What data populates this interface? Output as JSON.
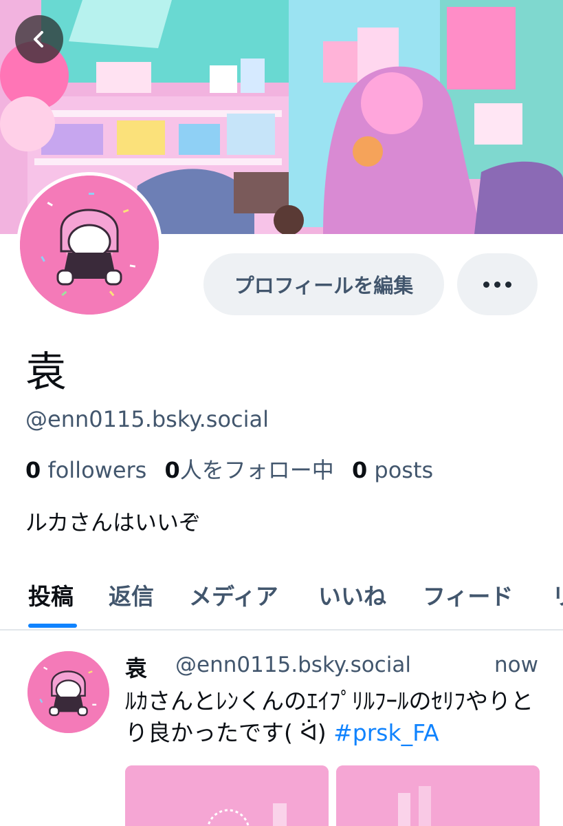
{
  "header": {
    "back_icon": "chevron-left-icon"
  },
  "profile": {
    "display_name": "袁",
    "handle": "@enn0115.bsky.social",
    "followers_count": "0",
    "followers_label": "followers",
    "following_count": "0",
    "following_label": "人をフォロー中",
    "posts_count": "0",
    "posts_label": "posts",
    "bio": "ルカさんはいいぞ"
  },
  "actions": {
    "edit_profile_label": "プロフィールを編集",
    "more_icon": "ellipsis-icon"
  },
  "tabs": [
    {
      "label": "投稿",
      "active": true
    },
    {
      "label": "返信",
      "active": false
    },
    {
      "label": "メディア",
      "active": false
    },
    {
      "label": "いいね",
      "active": false
    },
    {
      "label": "フィード",
      "active": false
    },
    {
      "label": "リ",
      "active": false
    }
  ],
  "post": {
    "author_name": "袁",
    "author_handle": "@enn0115.bsky.social",
    "time": "now",
    "text": "ﾙｶさんとﾚﾝくんのｴｲﾌﾟﾘﾙﾌｰﾙのｾﾘﾌやりとり良かったです( ᐛ) ",
    "hashtag": "#prsk_FA"
  },
  "colors": {
    "accent": "#1083fe",
    "muted_text": "#42566d",
    "button_bg": "#eef1f4"
  }
}
